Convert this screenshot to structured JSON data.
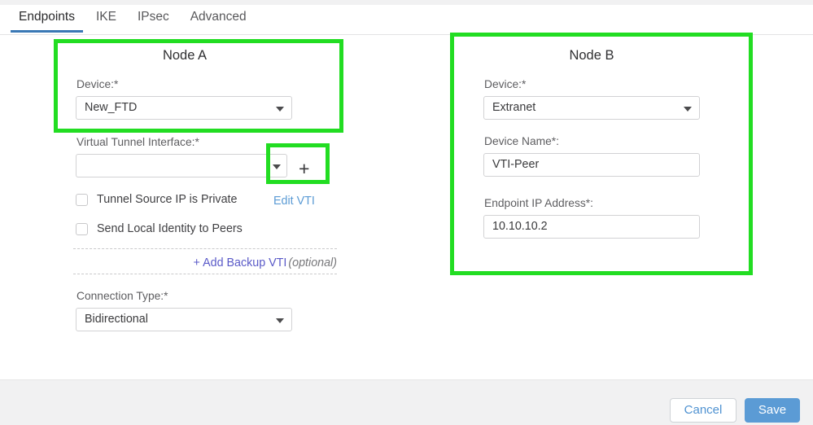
{
  "tabs": [
    {
      "label": "Endpoints",
      "active": true
    },
    {
      "label": "IKE",
      "active": false
    },
    {
      "label": "IPsec",
      "active": false
    },
    {
      "label": "Advanced",
      "active": false
    }
  ],
  "node_a": {
    "title": "Node A",
    "device_label": "Device:*",
    "device_value": "New_FTD",
    "vti_label": "Virtual Tunnel Interface:*",
    "vti_value": "",
    "vti_add_icon": "plus-icon",
    "checkbox_tunnel_source": "Tunnel Source IP is Private",
    "checkbox_send_identity": "Send Local Identity to Peers",
    "edit_vti_link": "Edit VTI",
    "add_backup_vti_link": "+ Add Backup VTI",
    "add_backup_vti_optional": "(optional)",
    "connection_type_label": "Connection Type:*",
    "connection_type_value": "Bidirectional"
  },
  "node_b": {
    "title": "Node B",
    "device_label": "Device:*",
    "device_value": "Extranet",
    "device_name_label": "Device Name*:",
    "device_name_value": "VTI-Peer",
    "endpoint_ip_label": "Endpoint IP Address*:",
    "endpoint_ip_value": "10.10.10.2"
  },
  "footer": {
    "cancel_label": "Cancel",
    "save_label": "Save"
  },
  "colors": {
    "annotation_green": "#22dd22",
    "tab_active_underline": "#3a78b5",
    "link_blue": "#5b9bd5",
    "link_purple": "#5a5ac8",
    "save_button": "#5b9bd5",
    "footer_background": "#f1f1f2"
  }
}
